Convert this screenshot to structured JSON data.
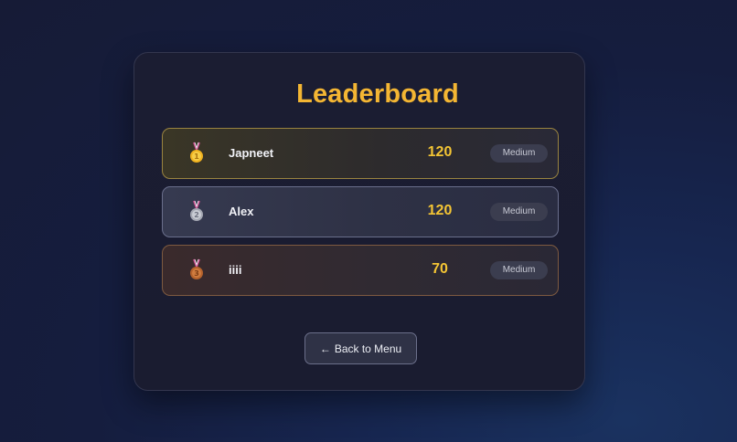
{
  "leaderboard": {
    "title": "Leaderboard",
    "entries": [
      {
        "rank": 1,
        "medal": "gold-medal-icon",
        "name": "Japneet",
        "score": "120",
        "difficulty": "Medium"
      },
      {
        "rank": 2,
        "medal": "silver-medal-icon",
        "name": "Alex",
        "score": "120",
        "difficulty": "Medium"
      },
      {
        "rank": 3,
        "medal": "bronze-medal-icon",
        "name": "iiii",
        "score": "70",
        "difficulty": "Medium"
      }
    ],
    "back_button": {
      "arrow": "←",
      "label": "Back to Menu"
    }
  },
  "colors": {
    "title": "#f4b633",
    "score": "#f4c534",
    "gold_border": "#9a8440",
    "silver_border": "#6a6f8c",
    "bronze_border": "#7e5a40"
  }
}
